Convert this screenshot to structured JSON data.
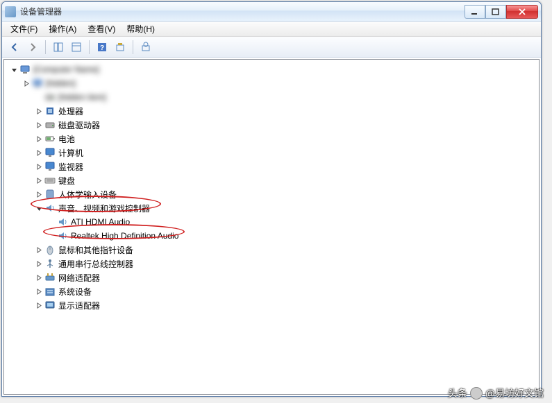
{
  "title": "设备管理器",
  "menu": {
    "file": "文件(F)",
    "action": "操作(A)",
    "view": "查看(V)",
    "help": "帮助(H)"
  },
  "root": {
    "name": "[Computer Name]"
  },
  "categories": [
    {
      "id": "cat-blur1",
      "label": "[hidden]",
      "icon": "computer",
      "blur": true,
      "indent": 1
    },
    {
      "id": "cat-blur2",
      "label": "[hidden item]",
      "icon": "drive",
      "blur": true,
      "indent": 2,
      "noexp": true
    },
    {
      "id": "cat-cpu",
      "label": "处理器",
      "icon": "chip",
      "indent": 2
    },
    {
      "id": "cat-disk",
      "label": "磁盘驱动器",
      "icon": "drive",
      "indent": 2
    },
    {
      "id": "cat-battery",
      "label": "电池",
      "icon": "battery",
      "indent": 2
    },
    {
      "id": "cat-computer",
      "label": "计算机",
      "icon": "monitor",
      "indent": 2
    },
    {
      "id": "cat-monitor",
      "label": "监视器",
      "icon": "monitor",
      "indent": 2
    },
    {
      "id": "cat-keyboard",
      "label": "键盘",
      "icon": "kb",
      "indent": 2
    },
    {
      "id": "cat-hid",
      "label": "人体学输入设备",
      "icon": "hid",
      "indent": 2
    },
    {
      "id": "cat-sound",
      "label": "声音、视频和游戏控制器",
      "icon": "sound",
      "indent": 2,
      "expanded": true
    },
    {
      "id": "dev-ati",
      "label": "ATI HDMI Audio",
      "icon": "sound",
      "indent": 3,
      "noexp": true
    },
    {
      "id": "dev-realtek",
      "label": "Realtek High Definition Audio",
      "icon": "sound",
      "indent": 3,
      "noexp": true
    },
    {
      "id": "cat-mouse",
      "label": "鼠标和其他指针设备",
      "icon": "mouse",
      "indent": 2
    },
    {
      "id": "cat-usb",
      "label": "通用串行总线控制器",
      "icon": "usb",
      "indent": 2
    },
    {
      "id": "cat-net",
      "label": "网络适配器",
      "icon": "net",
      "indent": 2
    },
    {
      "id": "cat-sys",
      "label": "系统设备",
      "icon": "sys",
      "indent": 2
    },
    {
      "id": "cat-disp",
      "label": "显示适配器",
      "icon": "disp",
      "indent": 2
    }
  ],
  "watermark": {
    "prefix": "头条",
    "text": "@易坊好文馆"
  }
}
